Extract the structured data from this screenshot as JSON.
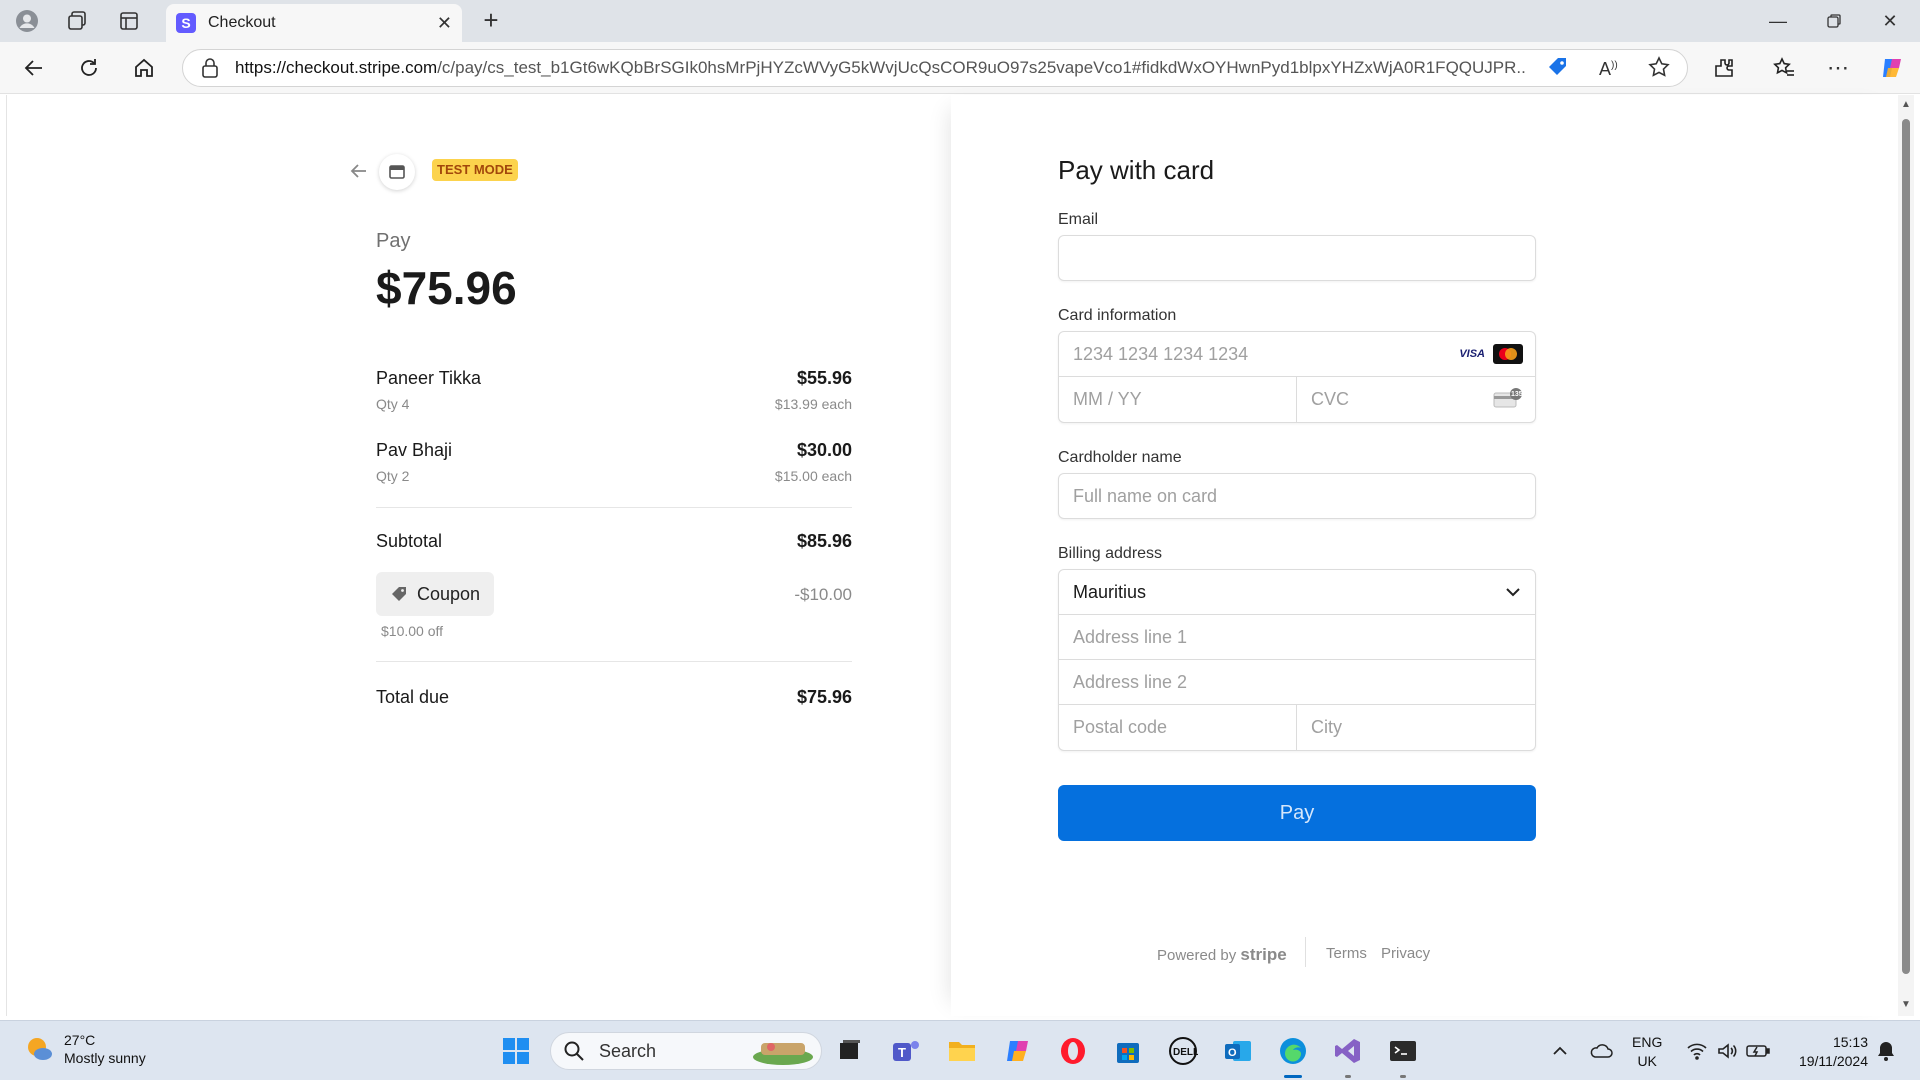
{
  "browser": {
    "tab_title": "Checkout",
    "tab_favicon_letter": "S",
    "url_host": "https://checkout.stripe.com",
    "url_path": "/c/pay/cs_test_b1Gt6wKQbBrSGIk0hsMrPjHYZcWVyG5kWvjUcQsCOR9uO97s25vapeVco1#fidkdWxOYHwnPyd1blpxYHZxWjA0R1FQQUJPR..."
  },
  "checkout": {
    "test_mode_badge": "TEST MODE",
    "pay_label": "Pay",
    "total_amount": "$75.96",
    "items": [
      {
        "name": "Paneer Tikka",
        "qty": "Qty 4",
        "amount": "$55.96",
        "each": "$13.99 each"
      },
      {
        "name": "Pav Bhaji",
        "qty": "Qty 2",
        "amount": "$30.00",
        "each": "$15.00 each"
      }
    ],
    "subtotal_label": "Subtotal",
    "subtotal_value": "$85.96",
    "coupon_label": "Coupon",
    "coupon_discount": "-$10.00",
    "coupon_note": "$10.00 off",
    "total_due_label": "Total due",
    "total_due_value": "$75.96"
  },
  "form": {
    "title": "Pay with card",
    "email_label": "Email",
    "email_value": "",
    "card_label": "Card information",
    "card_number_placeholder": "1234 1234 1234 1234",
    "expiry_placeholder": "MM / YY",
    "cvc_placeholder": "CVC",
    "cvc_badge": "135",
    "visa_label": "VISA",
    "cardholder_label": "Cardholder name",
    "cardholder_placeholder": "Full name on card",
    "billing_label": "Billing address",
    "country_value": "Mauritius",
    "address1_placeholder": "Address line 1",
    "address2_placeholder": "Address line 2",
    "postal_placeholder": "Postal code",
    "city_placeholder": "City",
    "pay_button": "Pay",
    "powered_by": "Powered by",
    "stripe_brand": "stripe",
    "terms_link": "Terms",
    "privacy_link": "Privacy",
    "pay_button_color": "#0570de",
    "test_badge_color": "#fcd34d"
  },
  "taskbar": {
    "weather_temp": "27°C",
    "weather_desc": "Mostly sunny",
    "search_label": "Search",
    "lang_line1": "ENG",
    "lang_line2": "UK",
    "time": "15:13",
    "date": "19/11/2024"
  }
}
